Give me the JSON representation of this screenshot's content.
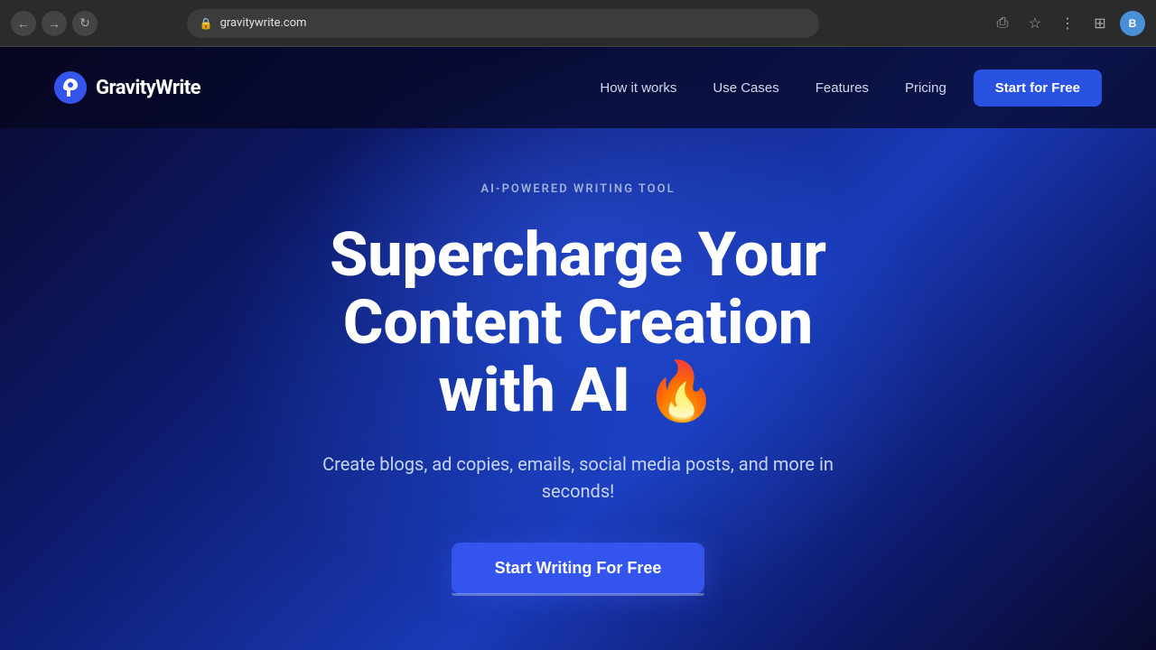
{
  "browser": {
    "url": "gravitywrite.com",
    "back_icon": "←",
    "forward_icon": "→",
    "refresh_icon": "↻",
    "share_icon": "⎙",
    "bookmark_icon": "☆",
    "extensions_icon": "⋮",
    "grid_icon": "⊞",
    "avatar_label": "B"
  },
  "navbar": {
    "logo_text": "GravityWrite",
    "nav_links": [
      {
        "label": "How it works",
        "id": "how-it-works"
      },
      {
        "label": "Use Cases",
        "id": "use-cases"
      },
      {
        "label": "Features",
        "id": "features"
      },
      {
        "label": "Pricing",
        "id": "pricing"
      }
    ],
    "cta_label": "Start for Free"
  },
  "hero": {
    "tag": "AI-POWERED WRITING TOOL",
    "title_line1": "Supercharge Your",
    "title_line2": "Content Creation",
    "title_line3": "with AI 🔥",
    "subtitle": "Create blogs, ad copies, emails, social media posts, and more in seconds!",
    "cta_label": "Start Writing For Free"
  }
}
